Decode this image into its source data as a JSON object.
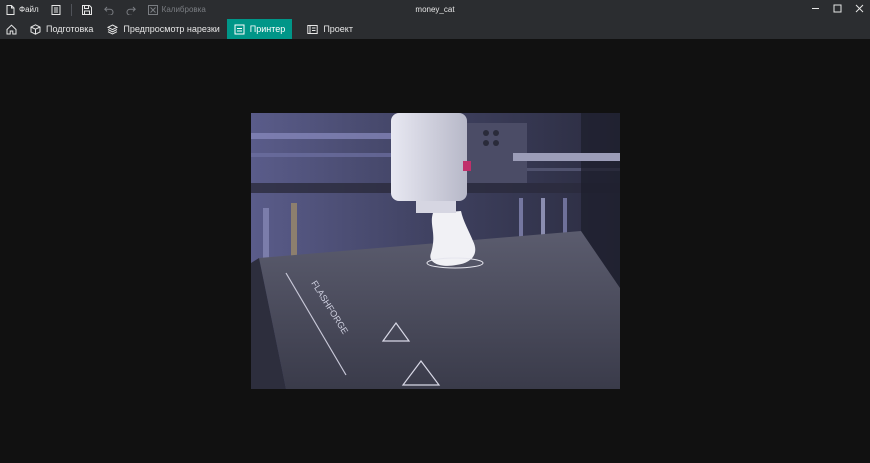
{
  "titlebar": {
    "file_menu": "Файл",
    "calibration": "Калибровка",
    "window_title": "money_cat"
  },
  "tabs": [
    {
      "label": "Подготовка"
    },
    {
      "label": "Предпросмотр нарезки"
    },
    {
      "label": "Принтер"
    },
    {
      "label": "Проект"
    }
  ],
  "active_tab": "Принтер",
  "camera": {
    "bed_brand": "FLASHFORGE"
  },
  "colors": {
    "chrome": "#2b2d30",
    "accent": "#009688",
    "background": "#111111"
  },
  "icons": [
    "file-icon",
    "list-icon",
    "save-icon",
    "undo-icon",
    "redo-icon",
    "calibration-icon",
    "minimize-icon",
    "maximize-icon",
    "close-icon",
    "home-icon",
    "cube-icon",
    "layers-icon",
    "printer-icon",
    "project-icon"
  ]
}
